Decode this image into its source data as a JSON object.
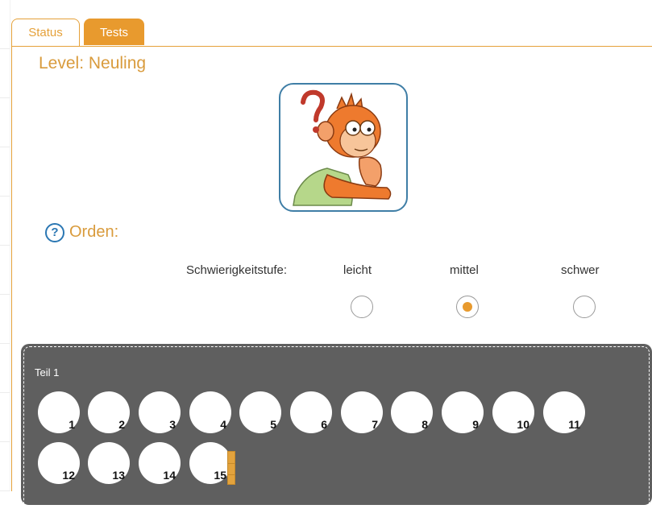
{
  "tabs": {
    "status": "Status",
    "tests": "Tests"
  },
  "level": {
    "title": "Level: Neuling"
  },
  "section": {
    "title": "Orden:",
    "help_icon": "?"
  },
  "difficulty": {
    "label": "Schwierigkeitstufe:",
    "options": [
      "leicht",
      "mittel",
      "schwer"
    ],
    "selected": "mittel"
  },
  "test": {
    "part_label": "Teil 1",
    "items": [
      "1",
      "2",
      "3",
      "4",
      "5",
      "6",
      "7",
      "8",
      "9",
      "10",
      "11",
      "12",
      "13",
      "14",
      "15"
    ]
  },
  "colors": {
    "accent": "#e89a2e",
    "title": "#d99b3c",
    "help": "#2b77b3",
    "card_border": "#3f7ea6",
    "test_bg": "#5f5f5f"
  }
}
